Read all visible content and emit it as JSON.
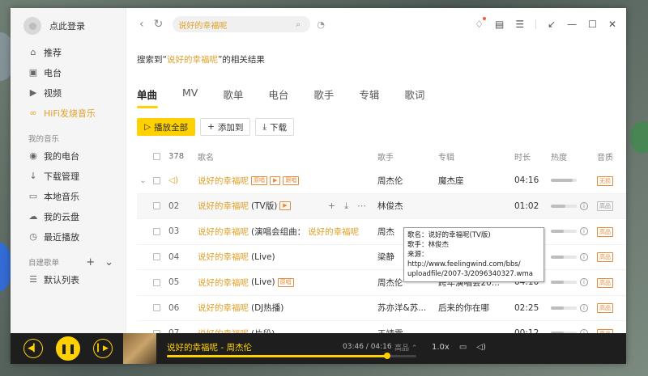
{
  "sidebar": {
    "login_label": "点此登录",
    "items_top": [
      {
        "icon": "home-icon",
        "glyph": "⌂",
        "label": "推荐"
      },
      {
        "icon": "radio-icon",
        "glyph": "▣",
        "label": "电台"
      },
      {
        "icon": "video-icon",
        "glyph": "▶",
        "label": "视频"
      },
      {
        "icon": "hifi-icon",
        "glyph": "∞",
        "label": "HiFi发烧音乐"
      }
    ],
    "my_music_heading": "我的音乐",
    "items_my": [
      {
        "icon": "my-radio-icon",
        "glyph": "◉",
        "label": "我的电台"
      },
      {
        "icon": "download-icon",
        "glyph": "↓",
        "label": "下载管理"
      },
      {
        "icon": "local-music-icon",
        "glyph": "▭",
        "label": "本地音乐"
      },
      {
        "icon": "cloud-icon",
        "glyph": "☁",
        "label": "我的云盘"
      },
      {
        "icon": "history-icon",
        "glyph": "◷",
        "label": "最近播放"
      }
    ],
    "playlist_heading": "自建歌单",
    "items_playlist": [
      {
        "icon": "list-icon",
        "glyph": "☰",
        "label": "默认列表"
      }
    ]
  },
  "topbar": {
    "search_value": "说好的幸福呢"
  },
  "content": {
    "result_prefix": "搜索到“",
    "result_keyword": "说好的幸福呢",
    "result_suffix": "”的相关结果",
    "tabs": [
      "单曲",
      "MV",
      "歌单",
      "电台",
      "歌手",
      "专辑",
      "歌词"
    ],
    "actions": {
      "play_all": "播放全部",
      "add_to": "添加到",
      "download": "下载"
    }
  },
  "table": {
    "headers": {
      "count": "378",
      "name": "歌名",
      "artist": "歌手",
      "album": "专辑",
      "duration": "时长",
      "heat": "热度",
      "quality": "音质"
    },
    "rows": [
      {
        "num": "",
        "name": "说好的幸福呢",
        "name_suffix": "",
        "tags": [
          "原唱",
          "▶",
          "跟唱"
        ],
        "artist": "周杰伦",
        "album": "魔杰座",
        "duration": "04:16",
        "heat": 0.85,
        "quality": "无损",
        "quality_style": "orange",
        "state": "playing"
      },
      {
        "num": "02",
        "name": "说好的幸福呢",
        "name_suffix": "(TV版)",
        "tags": [
          "▶"
        ],
        "artist": "林俊杰",
        "album": "",
        "duration": "01:02",
        "heat": 0.55,
        "quality": "高品",
        "quality_style": "gray",
        "state": "hover"
      },
      {
        "num": "03",
        "name": "说好的幸福呢",
        "name_suffix": " (演唱会组曲：",
        "name_suffix2": "说好的幸福呢",
        "tags": [],
        "artist": "周杰",
        "album": "",
        "duration": "3",
        "heat": 0.5,
        "quality": "高品",
        "quality_style": "orange",
        "state": ""
      },
      {
        "num": "04",
        "name": "说好的幸福呢",
        "name_suffix": "(Live)",
        "tags": [],
        "artist": "梁静",
        "album": "",
        "duration": "5",
        "heat": 0.5,
        "quality": "高品",
        "quality_style": "orange",
        "state": ""
      },
      {
        "num": "05",
        "name": "说好的幸福呢",
        "name_suffix": "(Live)",
        "tags": [
          "原唱"
        ],
        "artist": "周杰伦",
        "album": "跨年演唱会20...",
        "duration": "04:10",
        "heat": 0.5,
        "quality": "高品",
        "quality_style": "orange",
        "state": ""
      },
      {
        "num": "06",
        "name": "说好的幸福呢",
        "name_suffix": "(DJ热播)",
        "tags": [],
        "artist": "苏亦洋&苏...",
        "album": "后来的你在哪",
        "duration": "02:25",
        "heat": 0.5,
        "quality": "高品",
        "quality_style": "orange",
        "state": ""
      },
      {
        "num": "07",
        "name": "说好的幸福呢",
        "name_suffix": "(片段)",
        "tags": [],
        "artist": "王靖雯",
        "album": "",
        "duration": "00:12",
        "heat": 0.5,
        "quality": "高品",
        "quality_style": "orange",
        "state": ""
      }
    ]
  },
  "tooltip": {
    "line1": "歌名：说好的幸福呢(TV版)",
    "line2": "歌手：林俊杰",
    "line3": "来源：http://www.feelingwind.com/bbs/",
    "line4": "uploadfile/2007-3/2096340327.wma"
  },
  "player": {
    "title": "说好的幸福呢 - 周杰伦",
    "time": "03:46 / 04:16",
    "quality": "高品",
    "progress": 0.883,
    "speed": "1.0x"
  },
  "colors": {
    "accent": "#ffd100",
    "song_orange": "#e0a12a",
    "player_bg": "#1e1e1e"
  }
}
